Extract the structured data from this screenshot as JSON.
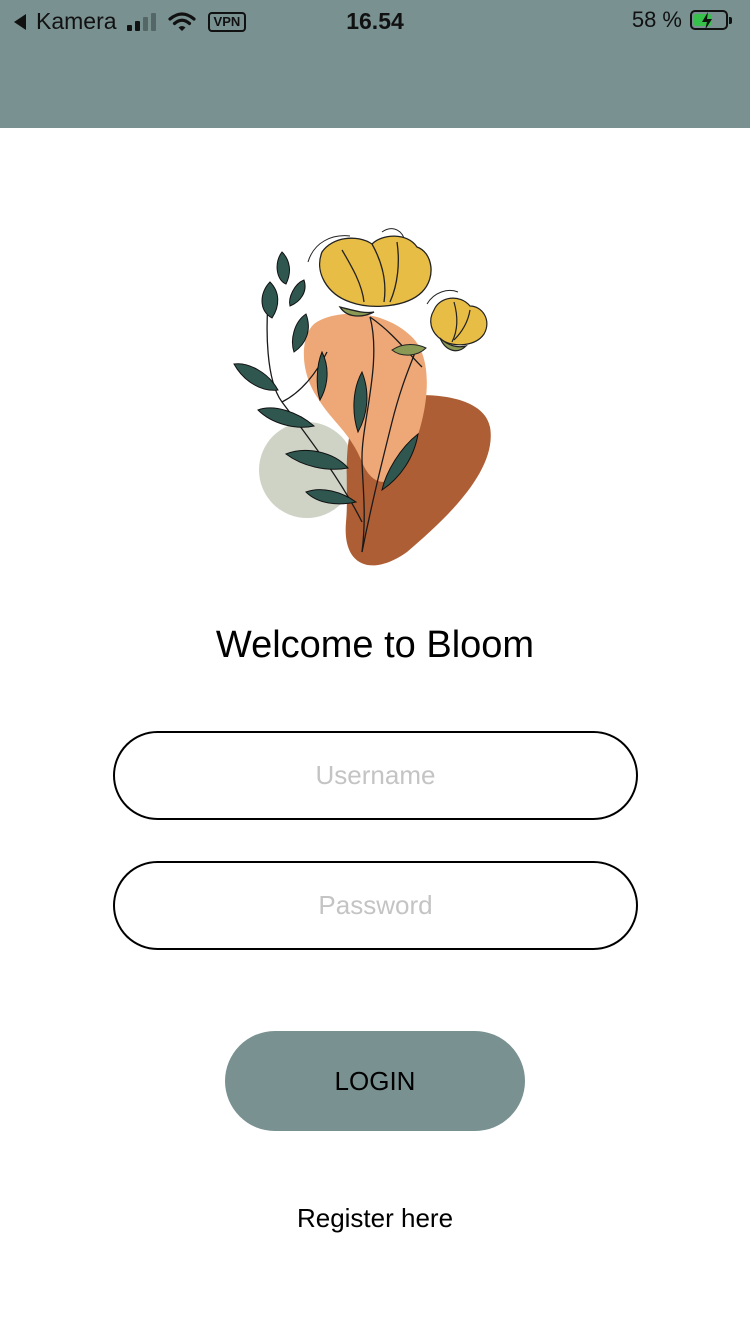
{
  "status_bar": {
    "back_app": "Kamera",
    "vpn": "VPN",
    "time": "16.54",
    "battery": "58 %",
    "battery_level": 0.58
  },
  "screen": {
    "title": "Welcome to Bloom",
    "username_placeholder": "Username",
    "password_placeholder": "Password",
    "login_label": "LOGIN",
    "register_link": "Register here"
  },
  "colors": {
    "header": "#7a9191",
    "button": "#7a9191",
    "leaf": "#2f5750",
    "petal": "#e8bd45",
    "blob_light": "#eea877",
    "blob_dark": "#ae5e34",
    "circle": "#cfd3c6"
  }
}
